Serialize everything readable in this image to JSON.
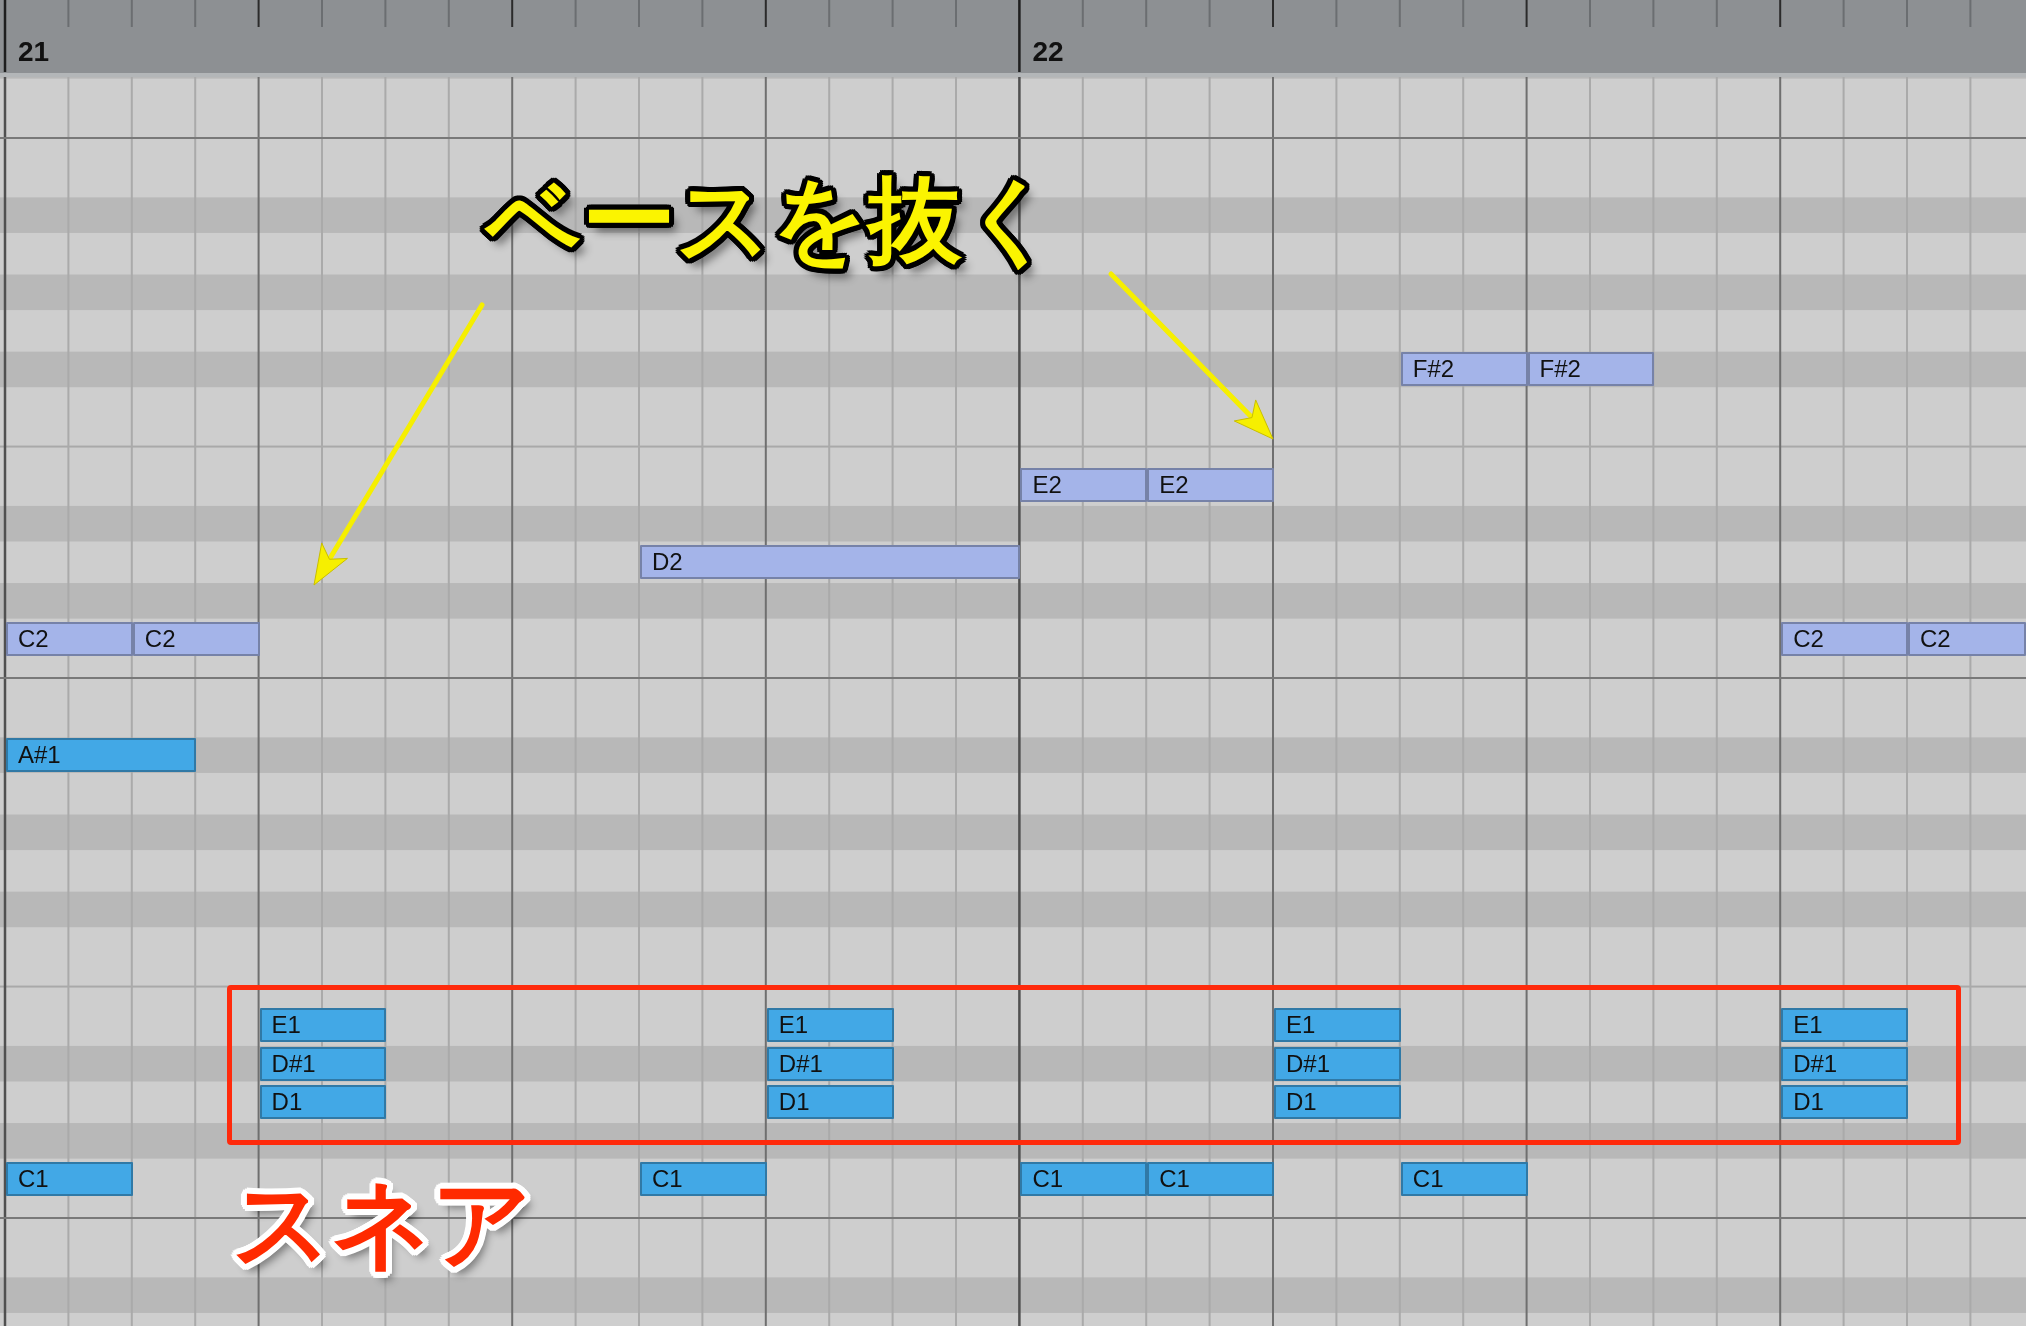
{
  "ruler": {
    "bars": [
      {
        "label": "21"
      },
      {
        "label": "22"
      }
    ]
  },
  "callouts": [
    {
      "kind": "arrows",
      "text": "ベースを抜く"
    },
    {
      "kind": "frame",
      "text": "スネア"
    }
  ],
  "notes": [
    {
      "label": "F#2",
      "color": "#a4b4e9"
    },
    {
      "label": "F#2",
      "color": "#a4b4e9"
    },
    {
      "label": "E2",
      "color": "#a4b4e9"
    },
    {
      "label": "E2",
      "color": "#a4b4e9"
    },
    {
      "label": "D2",
      "color": "#a4b4e9"
    },
    {
      "label": "C2",
      "color": "#a4b4e9"
    },
    {
      "label": "C2",
      "color": "#a4b4e9"
    },
    {
      "label": "C2",
      "color": "#a4b4e9"
    },
    {
      "label": "C2",
      "color": "#a4b4e9"
    },
    {
      "label": "A#1",
      "color": "#42a8e6"
    },
    {
      "label": "E1",
      "color": "#42a8e6"
    },
    {
      "label": "E1",
      "color": "#42a8e6"
    },
    {
      "label": "E1",
      "color": "#42a8e6"
    },
    {
      "label": "E1",
      "color": "#42a8e6"
    },
    {
      "label": "D#1",
      "color": "#42a8e6"
    },
    {
      "label": "D#1",
      "color": "#42a8e6"
    },
    {
      "label": "D#1",
      "color": "#42a8e6"
    },
    {
      "label": "D#1",
      "color": "#42a8e6"
    },
    {
      "label": "D1",
      "color": "#42a8e6"
    },
    {
      "label": "D1",
      "color": "#42a8e6"
    },
    {
      "label": "D1",
      "color": "#42a8e6"
    },
    {
      "label": "D1",
      "color": "#42a8e6"
    },
    {
      "label": "C1",
      "color": "#42a8e6"
    },
    {
      "label": "C1",
      "color": "#42a8e6"
    },
    {
      "label": "C1",
      "color": "#42a8e6"
    },
    {
      "label": "C1",
      "color": "#42a8e6"
    },
    {
      "label": "C1",
      "color": "#42a8e6"
    }
  ]
}
